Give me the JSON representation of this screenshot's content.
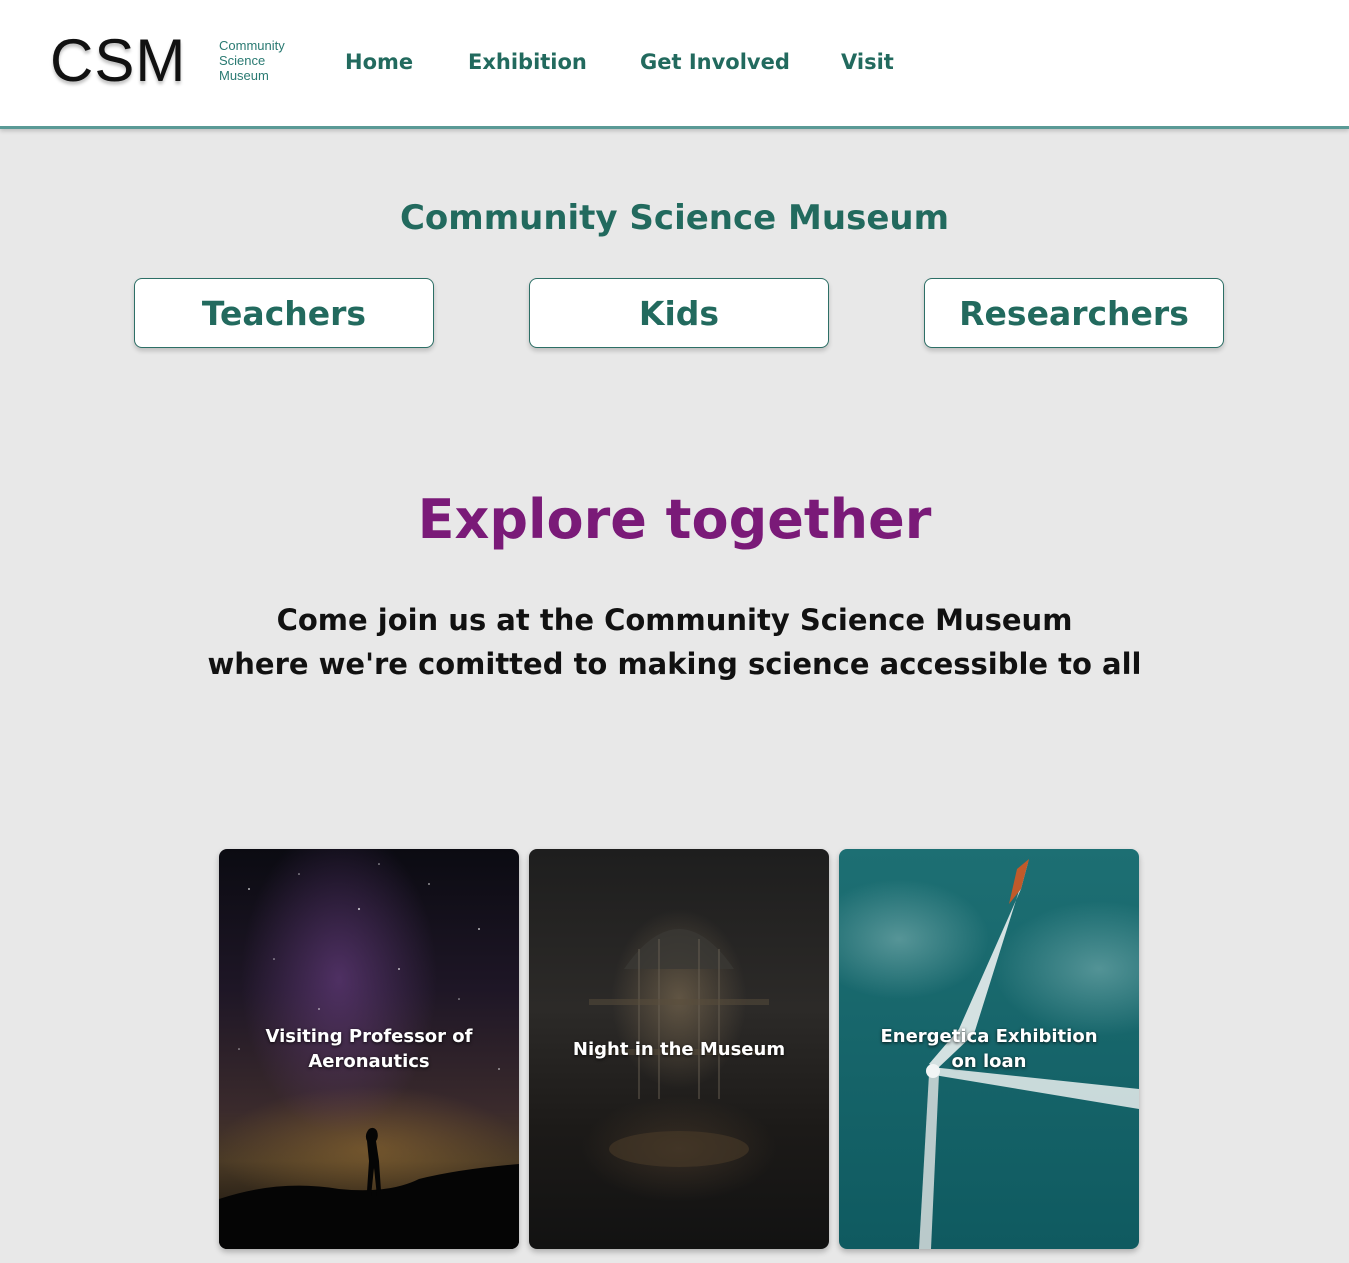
{
  "header": {
    "logo": "CSM",
    "logo_subtitle": [
      "Community",
      "Science",
      "Museum"
    ],
    "nav": [
      "Home",
      "Exhibition",
      "Get Involved",
      "Visit"
    ],
    "accent_color": "#226a5e"
  },
  "main": {
    "site_title": "Community Science Museum",
    "audience_buttons": [
      "Teachers",
      "Kids",
      "Researchers"
    ],
    "hero_title": "Explore together",
    "hero_lines": [
      "Come join us at the Community Science Museum",
      "where we're comitted to making science accessible to all"
    ],
    "hero_title_color": "#7a1a78"
  },
  "cards": [
    {
      "label": "Visiting Professor of Aeronautics",
      "image": "night-sky-silhouette"
    },
    {
      "label": "Night in the Museum",
      "image": "museum-hall-interior"
    },
    {
      "label": "Energetica Exhibition on loan",
      "image": "wind-turbine"
    }
  ]
}
